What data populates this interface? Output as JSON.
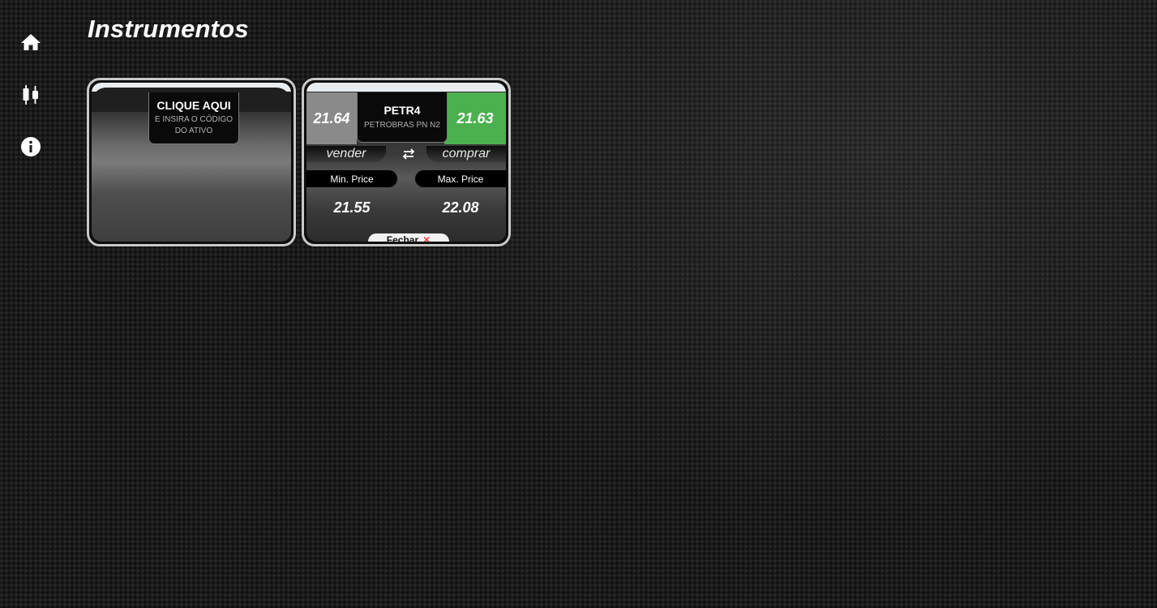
{
  "sidebar": {
    "items": [
      {
        "icon": "home-icon",
        "label": ""
      },
      {
        "icon": "candlestick-chart-icon",
        "label": ""
      },
      {
        "icon": "info-icon",
        "label": ""
      }
    ]
  },
  "page": {
    "title": "Instrumentos"
  },
  "empty_card": {
    "title": "CLIQUE AQUI",
    "subtitle": "E INSIRA O CÓDIGO DO ATIVO"
  },
  "instrument_card": {
    "ticker": "PETR4",
    "name": "PETROBRAS PN N2",
    "sell_price": "21.64",
    "buy_price": "21.63",
    "sell_label": "vender",
    "buy_label": "comprar",
    "min_label": "Min. Price",
    "max_label": "Max. Price",
    "min_value": "21.55",
    "max_value": "22.08",
    "close_label": "Fechar",
    "close_symbol": "✕",
    "colors": {
      "buy": "#4caf50",
      "sell": "#8a8a8a"
    }
  }
}
